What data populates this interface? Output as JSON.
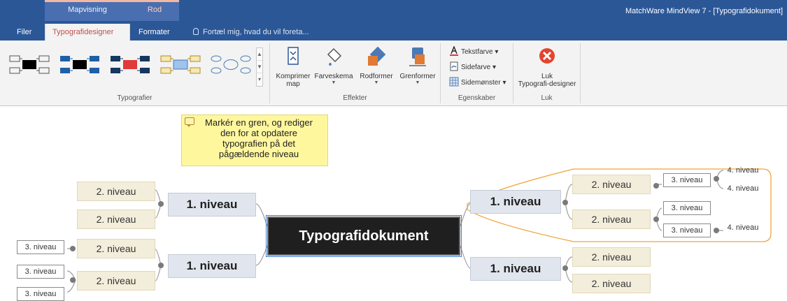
{
  "titlebar": {
    "app_title": "MatchWare MindView 7 - [Typografidokument]",
    "context_tabs": [
      "Mapvisning",
      "Rod"
    ]
  },
  "tabs": [
    "Filer",
    "Typografidesigner",
    "Formater"
  ],
  "tell_me": "Fortæl mig, hvad du vil foreta...",
  "ribbon": {
    "groups": {
      "typografier": "Typografier",
      "effekter": "Effekter",
      "egenskaber": "Egenskaber",
      "luk": "Luk"
    },
    "buttons": {
      "komprimer_1": "Komprimer",
      "komprimer_2": "map",
      "farveskema": "Farveskema",
      "rodformer": "Rodformer",
      "grenformer": "Grenformer",
      "tekstfarve": "Tekstfarve",
      "sidefarve": "Sidefarve",
      "sidemonster": "Sidemønster",
      "luk_1": "Luk",
      "luk_2": "Typografi-designer"
    },
    "colors": {
      "gallery_accent_black": "#000000",
      "gallery_accent_red": "#e03a3a",
      "gallery_accent_blue": "#9fc3ea",
      "close_red": "#e3452f",
      "ribbon_bg": "#f3f3f3",
      "topbar_bg": "#2b5797"
    }
  },
  "note": {
    "text_lines": [
      "Markér en gren, og rediger",
      "den for at opdatere",
      "typografien på det",
      "pågældende niveau"
    ]
  },
  "mindmap": {
    "root": "Typografidokument",
    "level1": [
      "1. niveau",
      "1. niveau",
      "1. niveau",
      "1. niveau"
    ],
    "level2_label": "2. niveau",
    "level3_label": "3. niveau",
    "level4_label": "4. niveau"
  }
}
